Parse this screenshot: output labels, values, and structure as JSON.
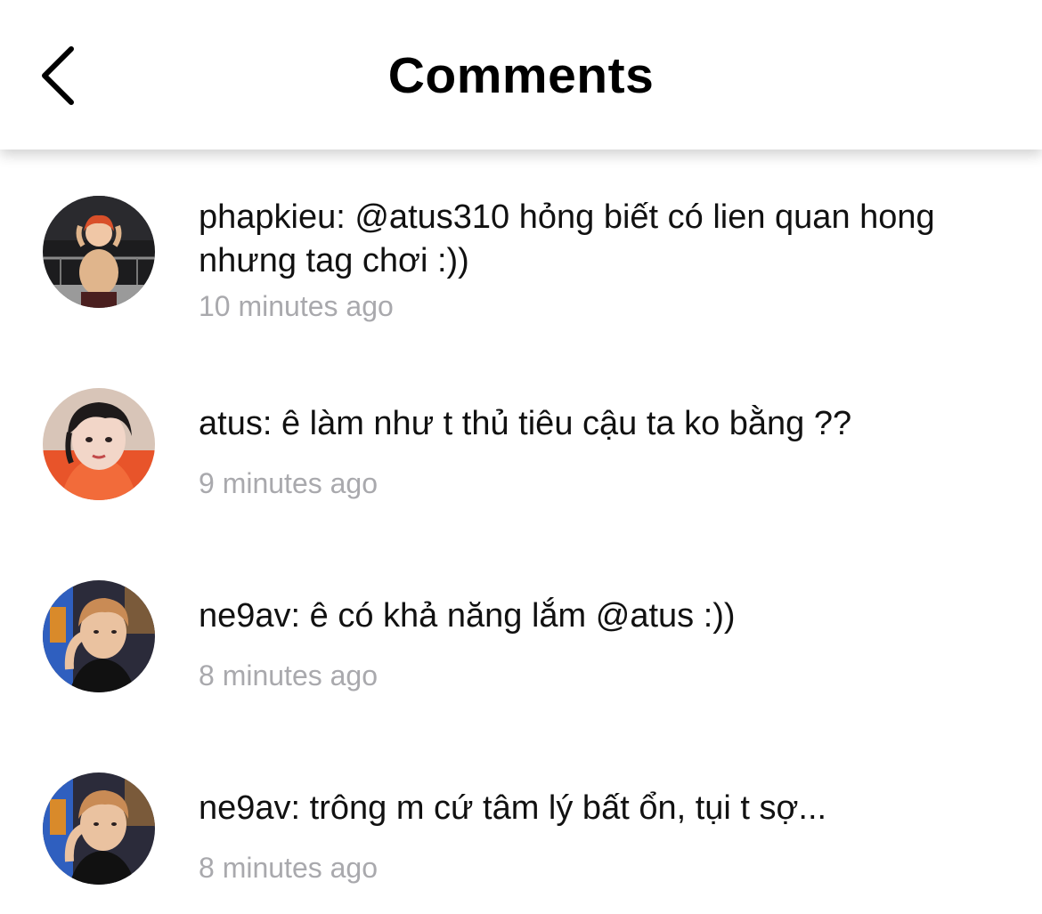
{
  "header": {
    "title": "Comments",
    "back_icon": "chevron-left-icon"
  },
  "comments": [
    {
      "text": "phapkieu: @atus310 hỏng biết có lien quan hong nhưng tag chơi :))",
      "time": "10 minutes ago",
      "avatar": "avatar-photo"
    },
    {
      "text": "atus: ê làm như t thủ tiêu cậu ta ko bằng ??",
      "time": "9 minutes ago",
      "avatar": "avatar-photo"
    },
    {
      "text": "ne9av: ê có khả năng lắm @atus :))",
      "time": "8 minutes ago",
      "avatar": "avatar-photo"
    },
    {
      "text": "ne9av: trông m cứ tâm lý bất ổn, tụi t sợ...",
      "time": "8 minutes ago",
      "avatar": "avatar-photo"
    }
  ],
  "colors": {
    "text": "#111111",
    "timestamp": "#a9a9ad",
    "background": "#ffffff"
  }
}
